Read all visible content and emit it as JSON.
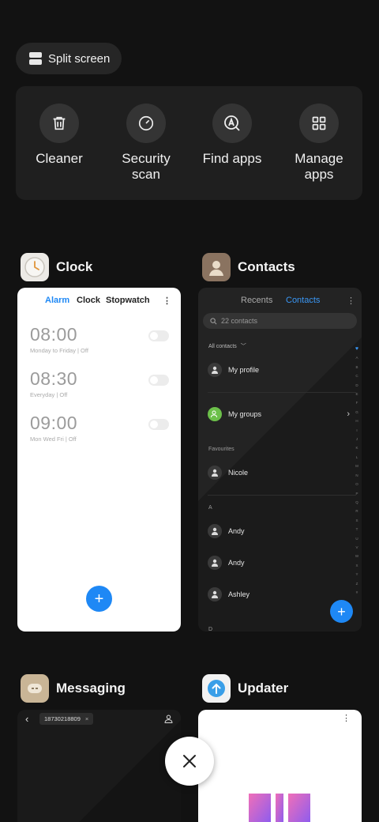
{
  "split_screen": {
    "label": "Split screen",
    "icon": "split-screen-icon"
  },
  "tools": [
    {
      "label": "Cleaner",
      "icon": "trash-icon"
    },
    {
      "label": "Security\nscan",
      "icon": "security-gauge-icon"
    },
    {
      "label": "Find apps",
      "icon": "find-apps-icon"
    },
    {
      "label": "Manage\napps",
      "icon": "grid-icon"
    }
  ],
  "apps": {
    "clock": {
      "name": "Clock",
      "tabs": {
        "alarm": "Alarm",
        "clock": "Clock",
        "stopwatch": "Stopwatch"
      },
      "alarms": [
        {
          "time": "08:00",
          "sub": "Monday to Friday | Off"
        },
        {
          "time": "08:30",
          "sub": "Everyday | Off"
        },
        {
          "time": "09:00",
          "sub": "Mon Wed Fri | Off"
        }
      ],
      "fab": "+"
    },
    "contacts": {
      "name": "Contacts",
      "tabs": {
        "recents": "Recents",
        "contacts": "Contacts"
      },
      "search_placeholder": "22 contacts",
      "filter": "All contacts",
      "my_profile": "My profile",
      "my_groups": "My groups",
      "favourites_header": "Favourites",
      "favourites": [
        "Nicole"
      ],
      "section_a": "A",
      "a_contacts": [
        "Andy",
        "Andy",
        "Ashley"
      ],
      "section_d": "D",
      "index_letters": "ABCDEFGHIJKLMNOPQRSTUVWXYZ#",
      "fab": "+"
    },
    "messaging": {
      "name": "Messaging",
      "recipient": "18730218809"
    },
    "updater": {
      "name": "Updater"
    }
  },
  "colors": {
    "accent": "#1e88f5",
    "background": "#121212",
    "group_green": "#6cc04a"
  }
}
